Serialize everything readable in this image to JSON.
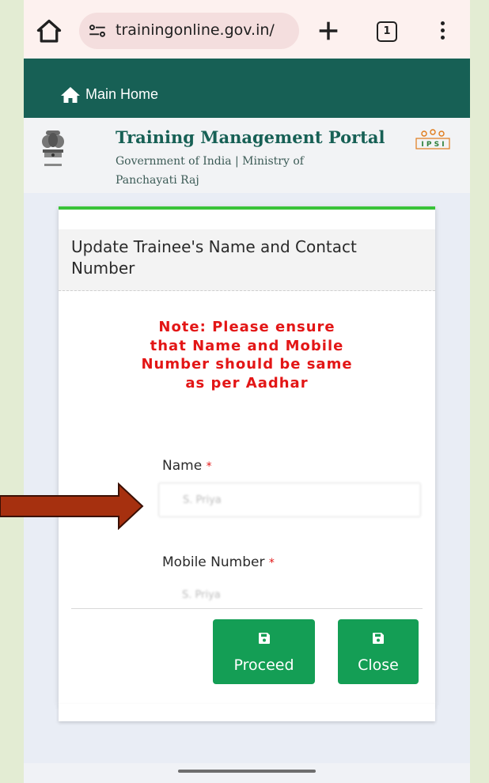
{
  "browser": {
    "url": "trainingonline.gov.in/",
    "tab_count": "1"
  },
  "nav": {
    "home_label": "Main Home"
  },
  "portal": {
    "title": "Training Management Portal",
    "subtitle": "Government of India | Ministry of Panchayati Raj"
  },
  "modal": {
    "title": "Update Trainee's Name and Contact Number",
    "note": "Note: Please ensure that Name and Mobile Number should be same as per Aadhar",
    "name_label": "Name",
    "name_value": "S. Priya",
    "mobile_label": "Mobile Number",
    "mobile_value": "S. Priya",
    "required_mark": "*",
    "proceed_label": "Proceed",
    "close_label": "Close"
  },
  "colors": {
    "nav_bg": "#176055",
    "accent_top": "#39c339",
    "button_bg": "#149e55",
    "note_red": "#e31616",
    "annotation_arrow": "#a6300f"
  },
  "icons": [
    "home-outline-icon",
    "site-info-icon",
    "plus-icon",
    "tabs-icon",
    "more-vert-icon",
    "home-icon",
    "emblem-icon",
    "ips-logo-icon",
    "save-icon",
    "arrow-right-icon"
  ]
}
